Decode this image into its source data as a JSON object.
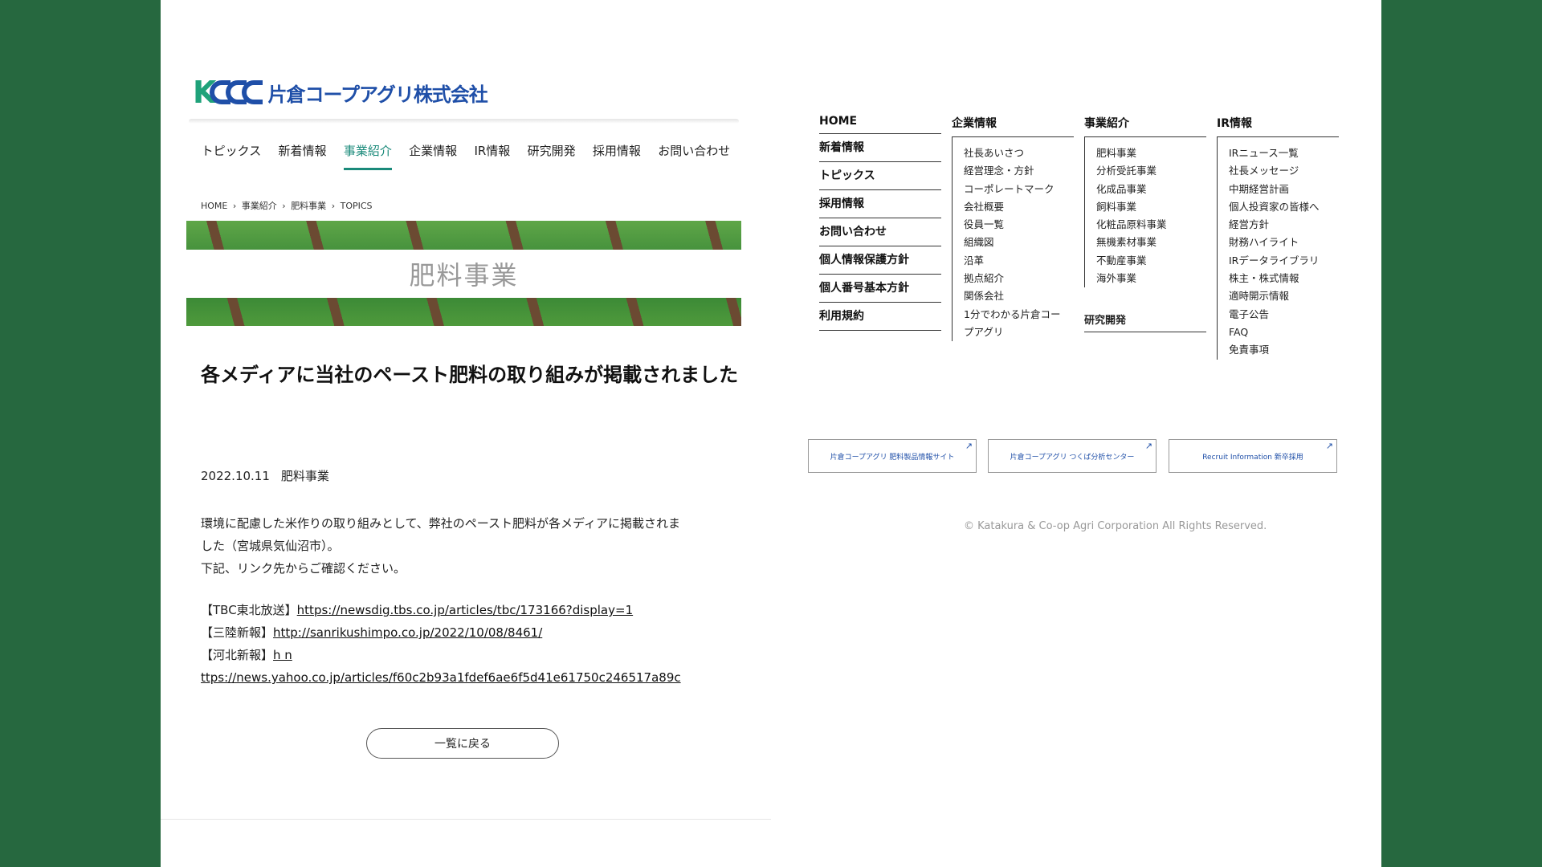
{
  "company": {
    "logo_letters": "KCC",
    "name": "片倉コープアグリ株式会社"
  },
  "nav": [
    "トピックス",
    "新着情報",
    "事業紹介",
    "企業情報",
    "IR情報",
    "研究開発",
    "採用情報",
    "お問い合わせ"
  ],
  "nav_active": "事業紹介",
  "breadcrumb": [
    "HOME",
    "›",
    "事業紹介",
    "›",
    "肥料事業",
    "›",
    "TOPICS"
  ],
  "banner_title": "肥料事業",
  "article": {
    "title": "各メディアに当社のペースト肥料の取り組みが掲載されました",
    "date": "2022.10.11",
    "category": "肥料事業",
    "body_lines": [
      "環境に配慮した米作りの取り組みとして、弊社のペースト肥料が各メディアに掲載されま",
      "した（宮城県気仙沼市）。",
      "下記、リンク先からご確認ください。"
    ],
    "links": [
      {
        "label": "【TBC東北放送】",
        "url": "https://newsdig.tbs.co.jp/articles/tbc/173166?display=1"
      },
      {
        "label": "【三陸新報】",
        "url": "http://sanrikushimpo.co.jp/2022/10/08/8461/"
      },
      {
        "label": "【河北新報】",
        "url": "h n"
      },
      {
        "label": "",
        "url": "ttps://news.yahoo.co.jp/articles/f60c2b93a1fdef6ae6f5d41e61750c246517a89c"
      }
    ],
    "back_button": "一覧に戻る"
  },
  "sitemap": {
    "col1": [
      "HOME",
      "新着情報",
      "トピックス",
      "採用情報",
      "お問い合わせ",
      "個人情報保護方針",
      "個人番号基本方針",
      "利用規約"
    ],
    "col2": {
      "title": "企業情報",
      "items": [
        "社長あいさつ",
        "経営理念・方針",
        "コーポレートマーク",
        "会社概要",
        "役員一覧",
        "組織図",
        "沿革",
        "拠点紹介",
        "関係会社",
        "1分でわかる片倉コー",
        "プアグリ"
      ]
    },
    "col3": {
      "title": "事業紹介",
      "items": [
        "肥料事業",
        "分析受託事業",
        "化成品事業",
        "飼料事業",
        "化粧品原料事業",
        "無機素材事業",
        "不動産事業",
        "海外事業"
      ],
      "extra": "研究開発"
    },
    "col4": {
      "title": "IR情報",
      "items": [
        "IRニュース一覧",
        "社長メッセージ",
        "中期経営計画",
        "個人投資家の皆様へ",
        "経営方針",
        "財務ハイライト",
        "IRデータライブラリ",
        "株主・株式情報",
        "適時開示情報",
        "電子公告",
        "FAQ",
        "免責事項"
      ]
    }
  },
  "external_links": [
    "片倉コープアグリ 肥料製品情報サイト",
    "片倉コープアグリ つくば分析センター",
    "Recruit Information 新卒採用"
  ],
  "copyright": "© Katakura & Co-op Agri Corporation All Rights Reserved.",
  "colors": {
    "background": "#26683f",
    "accent": "#1a8a7a",
    "brand_blue": "#1f4fa8"
  }
}
